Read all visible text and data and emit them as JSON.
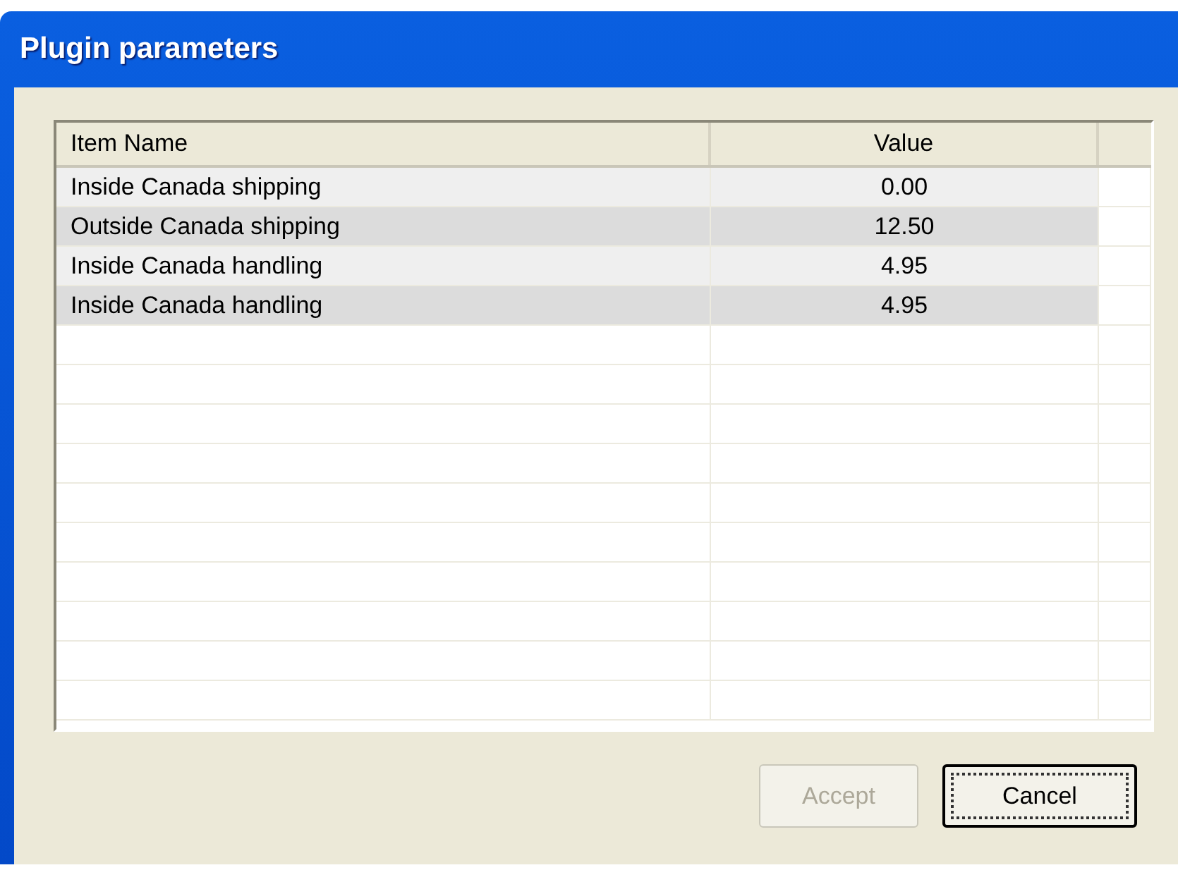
{
  "window": {
    "title": "Plugin parameters"
  },
  "table": {
    "columns": [
      "Item Name",
      "Value"
    ],
    "rows": [
      {
        "name": "Inside Canada shipping",
        "value": "0.00"
      },
      {
        "name": "Outside Canada shipping",
        "value": "12.50"
      },
      {
        "name": "Inside Canada handling",
        "value": "4.95"
      },
      {
        "name": "Inside Canada handling",
        "value": "4.95"
      }
    ]
  },
  "buttons": [
    {
      "label": "Accept",
      "disabled": true,
      "focused": false
    },
    {
      "label": "Cancel",
      "disabled": false,
      "focused": true
    }
  ]
}
